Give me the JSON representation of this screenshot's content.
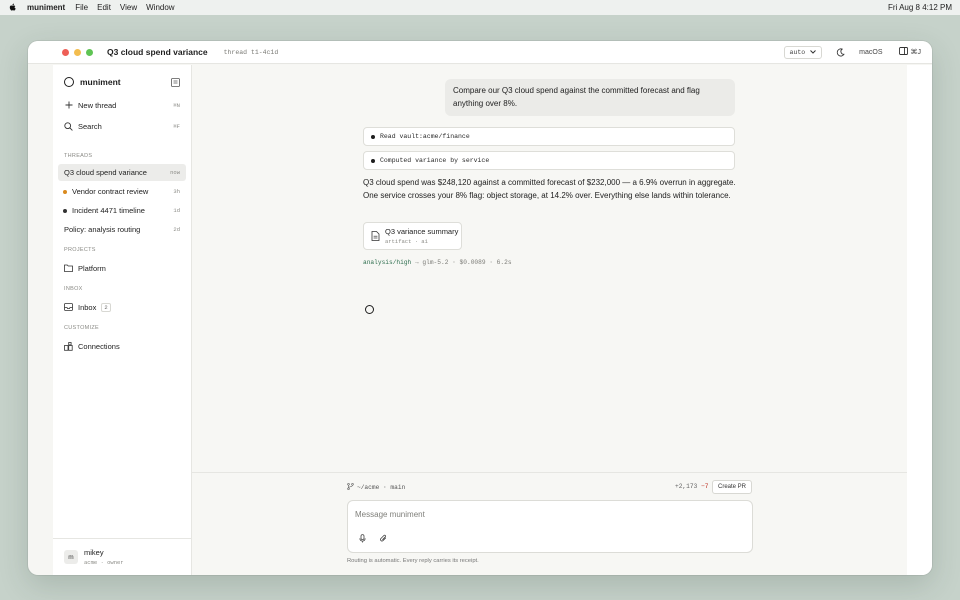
{
  "menubar": {
    "app": "muniment",
    "items": [
      "File",
      "Edit",
      "View",
      "Window"
    ],
    "clock": "Fri Aug 8  4:12 PM"
  },
  "window": {
    "title": "Q3 cloud spend variance",
    "thread_id": "thread t1-4c1d",
    "mode": "auto",
    "os_label": "macOS",
    "panel_shortcut": "⌘J"
  },
  "sidebar": {
    "brand": "muniment",
    "new_thread": {
      "label": "New thread",
      "kbd": "⌘N"
    },
    "search": {
      "label": "Search",
      "kbd": "⌘F"
    },
    "threads_label": "THREADS",
    "threads": [
      {
        "label": "Q3 cloud spend variance",
        "age": "now",
        "dot": "",
        "active": true
      },
      {
        "label": "Vendor contract review",
        "age": "3h",
        "dot": "#d98a1e"
      },
      {
        "label": "Incident 4471 timeline",
        "age": "1d",
        "dot": "#333333"
      },
      {
        "label": "Policy: analysis routing",
        "age": "2d",
        "dot": ""
      }
    ],
    "projects_label": "PROJECTS",
    "project": "Platform",
    "inbox_label": "INBOX",
    "inbox": {
      "label": "Inbox",
      "count": "2"
    },
    "customize_label": "CUSTOMIZE",
    "connections": "Connections",
    "user": {
      "initial": "m",
      "name": "mikey",
      "sub": "acme · owner"
    }
  },
  "conversation": {
    "user_message": "Compare our Q3 cloud spend against the committed forecast and flag anything over 8%.",
    "tool_calls": [
      "Read vault:acme/finance",
      "Computed variance by service"
    ],
    "answer": "Q3 cloud spend was $248,120 against a committed forecast of $232,000 — a 6.9% overrun in aggregate. One service crosses your 8% flag: object storage, at 14.2% over. Everything else lands within tolerance.",
    "artifact": {
      "title": "Q3 variance summary",
      "sub": "artifact · a1"
    },
    "route": {
      "tier": "analysis/high",
      "rest": " → glm-5.2 · $0.0089 · 6.2s"
    }
  },
  "composer": {
    "repo": "~/acme · main",
    "diff_add": "+2,173",
    "diff_del": "−7",
    "create_pr": "Create PR",
    "placeholder": "Message muniment",
    "footnote": "Routing is automatic. Every reply carries its receipt."
  }
}
